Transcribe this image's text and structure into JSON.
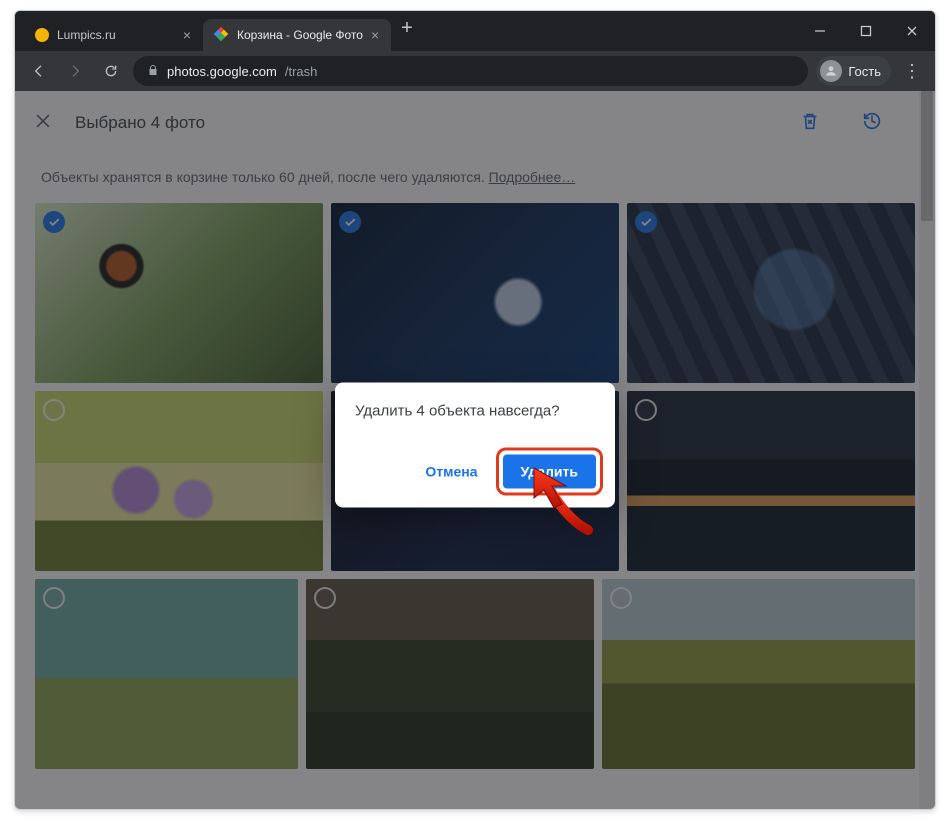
{
  "window": {
    "tabs": [
      {
        "label": "Lumpics.ru",
        "active": false
      },
      {
        "label": "Корзина - Google Фото",
        "active": true
      }
    ]
  },
  "addressbar": {
    "domain": "photos.google.com",
    "path": "/trash",
    "profile_label": "Гость"
  },
  "appbar": {
    "title": "Выбрано 4 фото"
  },
  "notice": {
    "text": "Объекты хранятся в корзине только 60 дней, после чего удаляются. ",
    "link": "Подробнее…"
  },
  "dialog": {
    "title": "Удалить 4 объекта навсегда?",
    "cancel": "Отмена",
    "confirm": "Удалить"
  },
  "photos": [
    {
      "id": "flowers",
      "selected": true
    },
    {
      "id": "tech-hand",
      "selected": true
    },
    {
      "id": "globe-kbd",
      "selected": true
    },
    {
      "id": "crocus",
      "selected": false
    },
    {
      "id": "cpu",
      "selected": true
    },
    {
      "id": "lake-boat",
      "selected": false
    },
    {
      "id": "lighthouse",
      "selected": false
    },
    {
      "id": "valley",
      "selected": false
    },
    {
      "id": "hills",
      "selected": false
    }
  ],
  "icons": {
    "close_tab": "×",
    "new_tab": "+",
    "kebab": "⋮"
  }
}
